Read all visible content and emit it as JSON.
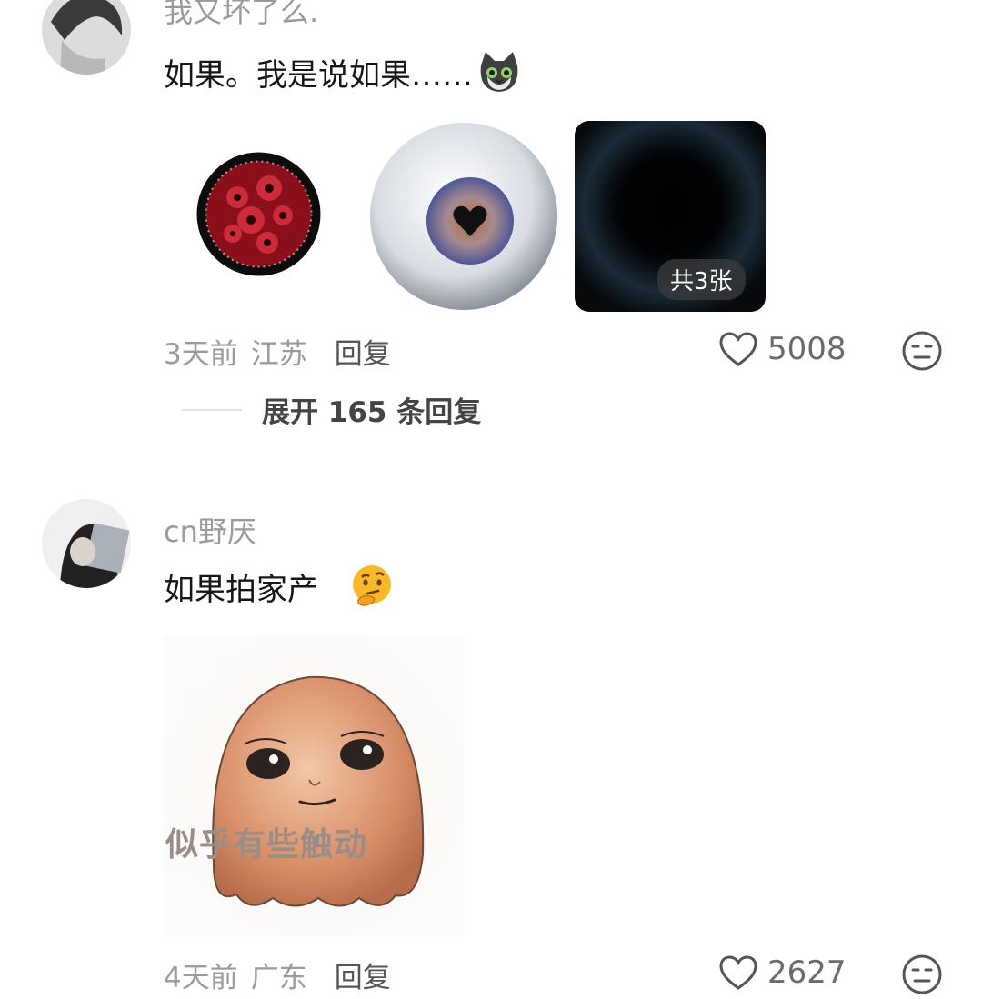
{
  "comments": [
    {
      "username": "我又坏了么.",
      "text": "如果。我是说如果……",
      "images_badge": "共3张",
      "time": "3天前",
      "location": "江苏",
      "reply_label": "回复",
      "likes": "5008",
      "expand_replies": "展开 165 条回复",
      "sticker_icon": "cat-emoji-icon",
      "images": [
        "red-eye-image",
        "heart-iris-eyeball-image",
        "dark-eye-image"
      ]
    },
    {
      "username": "cn野厌",
      "text": "如果拍家产",
      "emoji": "thinking-face-emoji-icon",
      "sticker_caption": "似乎有些触动",
      "time": "4天前",
      "location": "广东",
      "reply_label": "回复",
      "likes": "2627"
    }
  ],
  "colors": {
    "username": "#9a9a9a",
    "meta": "#9b9b9b",
    "text": "#161616"
  }
}
